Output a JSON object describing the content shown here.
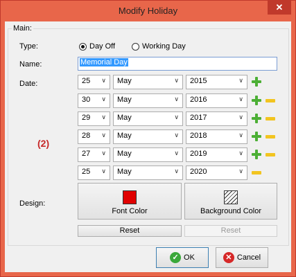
{
  "window": {
    "title": "Modify Holiday",
    "close_symbol": "✕"
  },
  "group": {
    "label": "Main:"
  },
  "type": {
    "label": "Type:",
    "options": [
      "Day Off",
      "Working Day"
    ],
    "selected": "Day Off"
  },
  "name": {
    "label": "Name:",
    "value": "Memorial Day"
  },
  "date": {
    "label": "Date:",
    "rows": [
      {
        "day": "25",
        "month": "May",
        "year": "2015",
        "plus": true,
        "minus": false
      },
      {
        "day": "30",
        "month": "May",
        "year": "2016",
        "plus": true,
        "minus": true
      },
      {
        "day": "29",
        "month": "May",
        "year": "2017",
        "plus": true,
        "minus": true
      },
      {
        "day": "28",
        "month": "May",
        "year": "2018",
        "plus": true,
        "minus": true
      },
      {
        "day": "27",
        "month": "May",
        "year": "2019",
        "plus": true,
        "minus": true
      },
      {
        "day": "25",
        "month": "May",
        "year": "2020",
        "plus": false,
        "minus": true
      }
    ]
  },
  "annotation": "(2)",
  "design": {
    "label": "Design:",
    "font_color_label": "Font Color",
    "font_color": "#e00000",
    "background_color_label": "Background Color",
    "reset_label": "Reset",
    "reset_label_2": "Reset"
  },
  "footer": {
    "ok_label": "OK",
    "cancel_label": "Cancel",
    "ok_icon": "✓",
    "cancel_icon": "✕"
  }
}
